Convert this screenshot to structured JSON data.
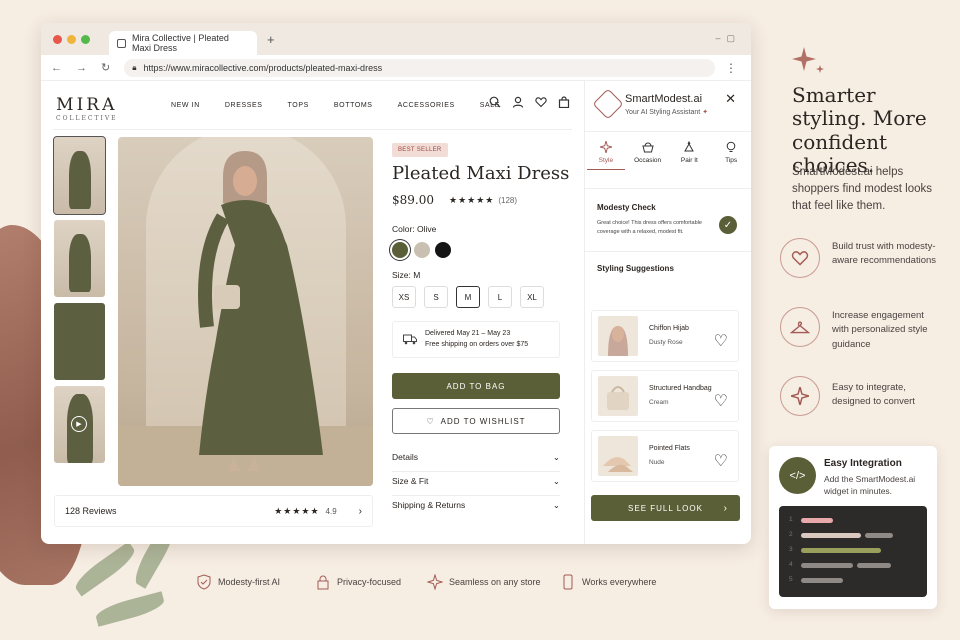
{
  "browser": {
    "tab_title": "Mira Collective | Pleated Maxi Dress",
    "url": "https://www.miracollective.com/products/pleated-maxi-dress"
  },
  "store": {
    "logo": "MIRA",
    "logo_sub": "COLLECTIVE",
    "nav": [
      "NEW IN",
      "DRESSES",
      "TOPS",
      "BOTTOMS",
      "ACCESSORIES",
      "SALE"
    ]
  },
  "product": {
    "badge": "BEST SELLER",
    "title": "Pleated Maxi Dress",
    "price": "$89.00",
    "rating_stars": "★★★★★",
    "rating_count": "(128)",
    "color_label": "Color: Olive",
    "colors": [
      "#5b5f37",
      "#c9c0b2",
      "#151515"
    ],
    "size_label": "Size: M",
    "sizes": [
      "XS",
      "S",
      "M",
      "L",
      "XL"
    ],
    "selected_size": "M",
    "delivery": "Delivered May 21 – May 23",
    "shipping": "Free shipping on orders over $75",
    "add_to_bag": "ADD TO BAG",
    "add_to_wishlist": "ADD TO WISHLIST",
    "accordions": [
      "Details",
      "Size & Fit",
      "Shipping & Returns"
    ],
    "reviews_label": "128 Reviews",
    "reviews_stars": "★★★★★",
    "reviews_score": "4.9"
  },
  "assistant": {
    "name": "SmartModest.ai",
    "subtitle": "Your AI Styling Assistant",
    "tabs": [
      "Style",
      "Occasion",
      "Pair It",
      "Tips"
    ],
    "modesty_title": "Modesty Check",
    "modesty_text": "Great choice! This dress offers comfortable coverage with a relaxed, modest fit.",
    "suggestions_title": "Styling Suggestions",
    "suggestions": [
      {
        "name": "Chiffon Hijab",
        "variant": "Dusty Rose"
      },
      {
        "name": "Structured Handbag",
        "variant": "Cream"
      },
      {
        "name": "Pointed Flats",
        "variant": "Nude"
      }
    ],
    "cta": "SEE FULL LOOK"
  },
  "marketing": {
    "headline": "Smarter styling. More confident choices.",
    "paragraph": "SmartModest.ai helps shoppers find modest looks that feel like them.",
    "features": [
      "Build trust with modesty-aware recommendations",
      "Increase engagement with personalized style guidance",
      "Easy to integrate, designed to convert"
    ],
    "integration_title": "Easy Integration",
    "integration_text": "Add the SmartModest.ai widget in minutes.",
    "code_lines": [
      "1",
      "2",
      "3",
      "4",
      "5"
    ],
    "trust": [
      "Modesty-first AI",
      "Privacy-focused",
      "Seamless on any store",
      "Works everywhere"
    ]
  },
  "colors": {
    "olive": "#5b5f37",
    "rose": "#a35c55",
    "cream": "#f6ede3"
  }
}
